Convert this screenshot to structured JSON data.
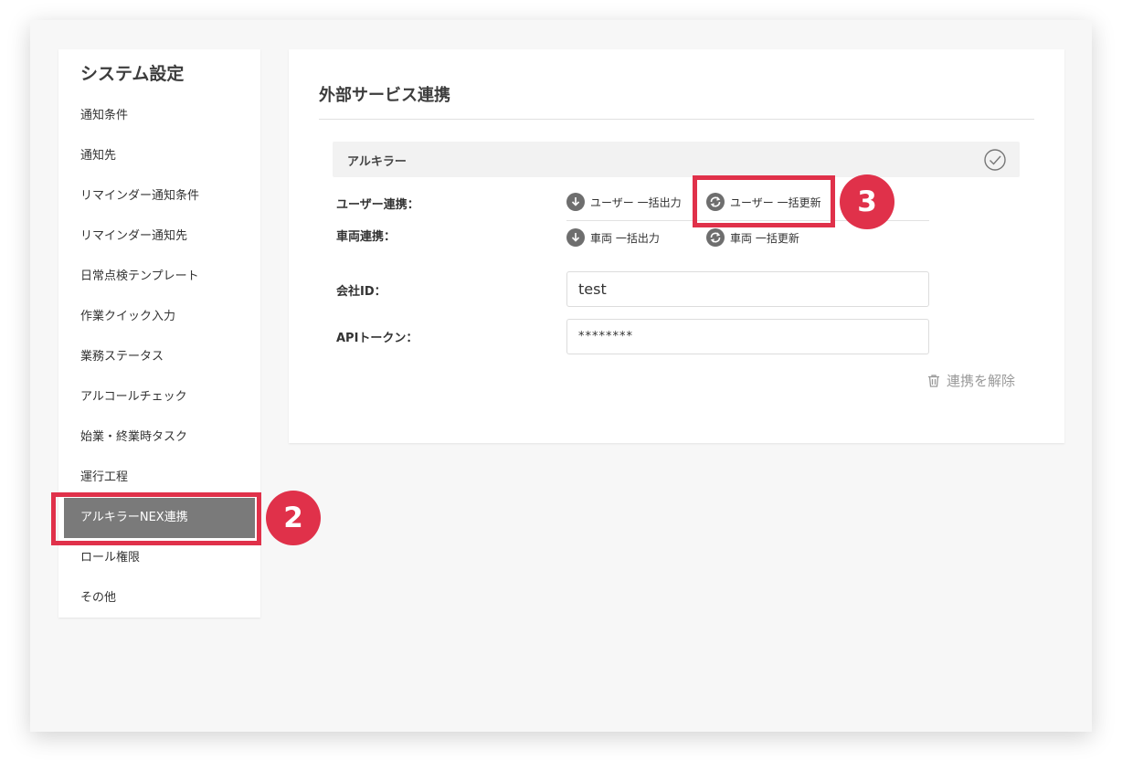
{
  "sidebar": {
    "title": "システム設定",
    "items": [
      {
        "label": "通知条件"
      },
      {
        "label": "通知先"
      },
      {
        "label": "リマインダー通知条件"
      },
      {
        "label": "リマインダー通知先"
      },
      {
        "label": "日常点検テンプレート"
      },
      {
        "label": "作業クイック入力"
      },
      {
        "label": "業務ステータス"
      },
      {
        "label": "アルコールチェック"
      },
      {
        "label": "始業・終業時タスク"
      },
      {
        "label": "運行工程"
      },
      {
        "label": "アルキラーNEX連携",
        "active": true
      },
      {
        "label": "ロール権限"
      },
      {
        "label": "その他"
      }
    ]
  },
  "main": {
    "title": "外部サービス連携",
    "service": {
      "name": "アルキラー",
      "status_icon": "check-circle-icon"
    },
    "user_link": {
      "label": "ユーザー連携：",
      "export_label": "ユーザー 一括出力",
      "update_label": "ユーザー 一括更新"
    },
    "vehicle_link": {
      "label": "車両連携：",
      "export_label": "車両 一括出力",
      "update_label": "車両 一括更新"
    },
    "company_id": {
      "label": "会社ID：",
      "value": "test"
    },
    "api_token": {
      "label": "APIトークン：",
      "value": "********"
    },
    "unlink_label": "連携を解除"
  },
  "annotations": {
    "step2": "2",
    "step3": "3",
    "color": "#e0314a"
  },
  "colors": {
    "active_menu_bg": "#7a7a7a",
    "icon_gray": "#6e6e6e",
    "muted_text": "#9a9a9a"
  }
}
